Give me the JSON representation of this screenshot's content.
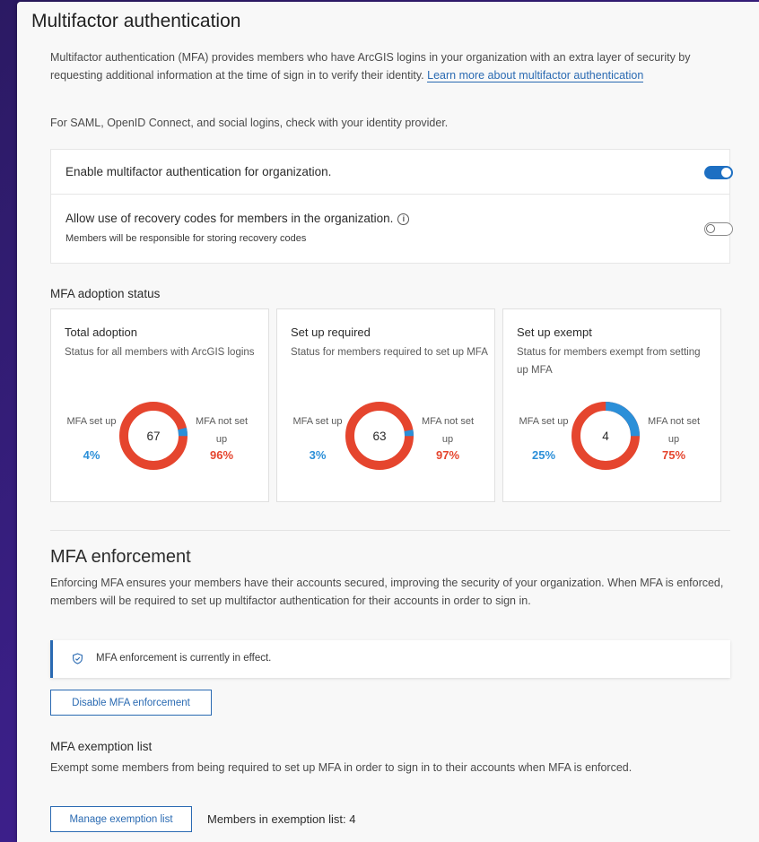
{
  "mfa": {
    "title": "Multifactor authentication",
    "description": "Multifactor authentication (MFA) provides members who have ArcGIS logins in your organization with an extra layer of security by requesting additional information at the time of sign in to verify their identity.",
    "learn_more_link": "Learn more about multifactor authentication",
    "identity_note": "For SAML, OpenID Connect, and social logins, check with your identity provider."
  },
  "settings": {
    "enable_label": "Enable multifactor authentication for organization.",
    "enable_on": true,
    "recovery_label": "Allow use of recovery codes for members in the organization.",
    "recovery_sub": "Members will be responsible for storing recovery codes",
    "recovery_on": false
  },
  "adoption": {
    "section_label": "MFA adoption status",
    "set_up_label": "MFA set up",
    "not_set_up_label": "MFA not set up",
    "colors": {
      "set_up": "#2b8fd8",
      "not_set_up": "#e5452e"
    },
    "cards": [
      {
        "title": "Total adoption",
        "subtitle": "Status for all members with ArcGIS logins",
        "count": "67",
        "set_up_pct": "4%",
        "not_set_up_pct": "96%",
        "set_up_fraction": 0.04
      },
      {
        "title": "Set up required",
        "subtitle": "Status for members required to set up MFA",
        "count": "63",
        "set_up_pct": "3%",
        "not_set_up_pct": "97%",
        "set_up_fraction": 0.03
      },
      {
        "title": "Set up exempt",
        "subtitle": "Status for members exempt from setting up MFA",
        "count": "4",
        "set_up_pct": "25%",
        "not_set_up_pct": "75%",
        "set_up_fraction": 0.25
      }
    ]
  },
  "enforcement": {
    "title": "MFA enforcement",
    "description": "Enforcing MFA ensures your members have their accounts secured, improving the security of your organization. When MFA is enforced, members will be required to set up multifactor authentication for their accounts in order to sign in.",
    "notice": "MFA enforcement is currently in effect.",
    "disable_button": "Disable MFA enforcement"
  },
  "exemption": {
    "title": "MFA exemption list",
    "description": "Exempt some members from being required to set up MFA in order to sign in to their accounts when MFA is enforced.",
    "manage_button": "Manage exemption list",
    "count_text": "Members in exemption list: 4"
  }
}
